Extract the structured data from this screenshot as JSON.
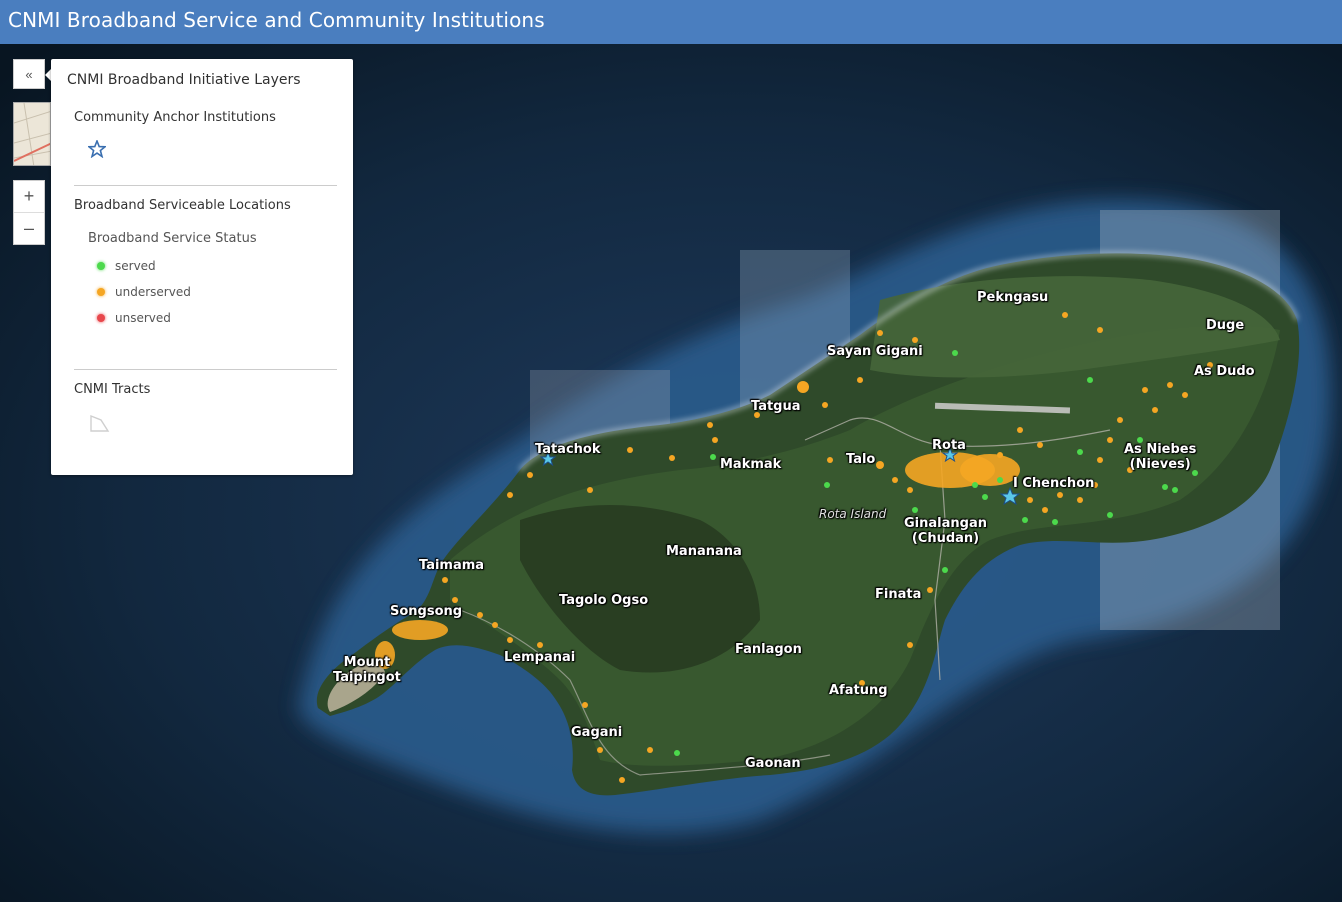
{
  "app": {
    "title": "CNMI Broadband Service and Community Institutions"
  },
  "controls": {
    "collapse_icon": "«",
    "zoom_in": "+",
    "zoom_out": "–"
  },
  "legend": {
    "title": "CNMI Broadband Initiative Layers",
    "layers": [
      {
        "name": "Community Anchor Institutions",
        "symbol": "star-icon",
        "symbol_color": "#3a6fb0"
      },
      {
        "name": "Broadband Serviceable Locations",
        "field": "Broadband Service Status",
        "classes": [
          {
            "label": "served",
            "color": "#4cd94c"
          },
          {
            "label": "underserved",
            "color": "#f5a623"
          },
          {
            "label": "unserved",
            "color": "#e8474c"
          }
        ]
      },
      {
        "name": "CNMI Tracts",
        "symbol": "polygon-outline-icon"
      }
    ]
  },
  "map": {
    "island_label": "Rota Island",
    "places": [
      "Pekngasu",
      "Duge",
      "Sayan Gigani",
      "As Dudo",
      "Tatgua",
      "Rota",
      "As Niebes\n(Nieves)",
      "Tatachok",
      "Makmak",
      "Talo",
      "I Chenchon",
      "Ginalangan\n(Chudan)",
      "Mananana",
      "Taimama",
      "Songsong",
      "Tagolo Ogso",
      "Finata",
      "Mount\nTaipingot",
      "Lempanai",
      "Fanlagon",
      "Afatung",
      "Gagani",
      "Gaonan"
    ]
  }
}
